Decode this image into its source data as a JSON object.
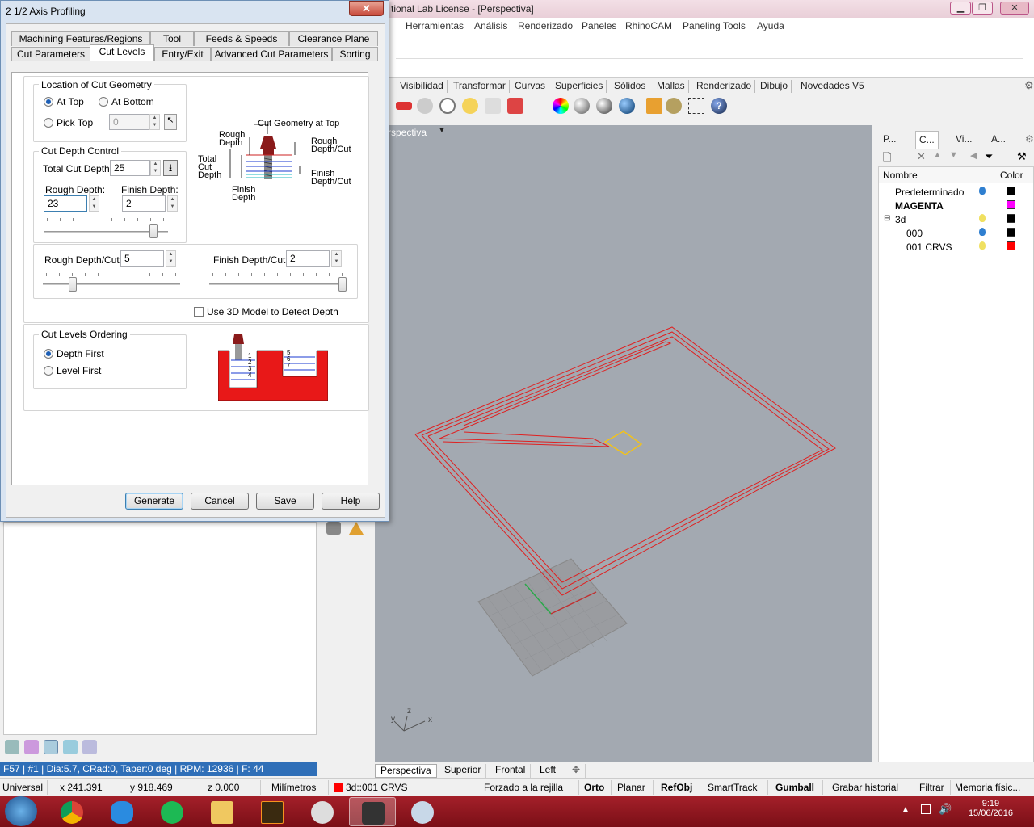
{
  "main_window": {
    "title": "tional Lab License - [Perspectiva]",
    "menu": [
      "Herramientas",
      "Análisis",
      "Renderizado",
      "Paneles",
      "RhinoCAM",
      "Paneling Tools",
      "Ayuda"
    ],
    "toolbar_tabs": [
      "Visibilidad",
      "Transformar",
      "Curvas",
      "Superficies",
      "Sólidos",
      "Mallas",
      "Renderizado",
      "Dibujo",
      "Novedades V5"
    ]
  },
  "viewport": {
    "title": "rspectiva",
    "tabs": [
      "Perspectiva",
      "Superior",
      "Frontal",
      "Left"
    ],
    "axis_x": "x",
    "axis_y": "y",
    "axis_z": "z"
  },
  "layers_panel": {
    "tabs": [
      "P...",
      "C...",
      "Vi...",
      "A..."
    ],
    "col_name": "Nombre",
    "col_color": "Color",
    "rows": [
      {
        "name": "Predeterminado",
        "bulb": "#2f7fd0",
        "color": "#000000",
        "bold": false,
        "indent": 0
      },
      {
        "name": "MAGENTA",
        "bulb": "",
        "color": "#ff00ff",
        "bold": true,
        "indent": 0
      },
      {
        "name": "3d",
        "bulb": "#f0e060",
        "color": "#000000",
        "bold": false,
        "indent": 0
      },
      {
        "name": "000",
        "bulb": "#2f7fd0",
        "color": "#000000",
        "bold": false,
        "indent": 1
      },
      {
        "name": "001 CRVS",
        "bulb": "#f0e060",
        "color": "#ff0000",
        "bold": false,
        "indent": 1
      }
    ]
  },
  "left_panel": {
    "status": "F57 | #1 | Dia:5.7, CRad:0, Taper:0 deg | RPM: 12936 | F: 44"
  },
  "statusbar": {
    "cplane": "Universal",
    "x": "x 241.391",
    "y": "y 918.469",
    "z": "z 0.000",
    "units": "Milímetros",
    "layer": "3d::001 CRVS",
    "layer_color": "#ff0000",
    "snap": "Forzado a la rejilla",
    "orto": "Orto",
    "planar": "Planar",
    "refobj": "RefObj",
    "smarttrack": "SmartTrack",
    "gumball": "Gumball",
    "history": "Grabar historial",
    "filter": "Filtrar",
    "memory": "Memoria físic..."
  },
  "taskbar": {
    "time": "9:19",
    "date": "15/06/2016"
  },
  "dialog": {
    "title": "2 1/2 Axis Profiling",
    "close": "✕",
    "tabs_row1": [
      "Machining Features/Regions",
      "Tool",
      "Feeds & Speeds",
      "Clearance Plane"
    ],
    "tabs_row2": [
      "Cut Parameters",
      "Cut Levels",
      "Entry/Exit",
      "Advanced Cut Parameters",
      "Sorting"
    ],
    "location_group": "Location of Cut Geometry",
    "at_top": "At Top",
    "at_bottom": "At Bottom",
    "pick_top": "Pick Top",
    "pick_top_value": "0",
    "depth_group": "Cut Depth Control",
    "total_cut_depth_label": "Total Cut Depth:",
    "total_cut_depth": "25",
    "rough_depth_label": "Rough Depth:",
    "rough_depth": "23",
    "finish_depth_label": "Finish Depth:",
    "finish_depth": "2",
    "rough_depth_cut_label": "Rough Depth/Cut:",
    "rough_depth_cut": "5",
    "finish_depth_cut_label": "Finish Depth/Cut:",
    "finish_depth_cut": "2",
    "use_3d_model": "Use 3D Model to Detect Depth",
    "ordering_group": "Cut Levels Ordering",
    "depth_first": "Depth First",
    "level_first": "Level First",
    "diagram": {
      "cut_geometry_at_top": "Cut Geometry at Top",
      "rough_depth_1": "Rough",
      "rough_depth_2": "Depth",
      "total_1": "Total",
      "total_2": "Cut",
      "total_3": "Depth",
      "finish_1": "Finish",
      "finish_2": "Depth",
      "rough_dc_1": "Rough",
      "rough_dc_2": "Depth/Cut",
      "finish_dc_1": "Finish",
      "finish_dc_2": "Depth/Cut"
    },
    "order_numbers_left": [
      "1",
      "2",
      "3",
      "4"
    ],
    "order_numbers_right": [
      "5",
      "6",
      "7"
    ],
    "buttons": {
      "generate": "Generate",
      "cancel": "Cancel",
      "save": "Save",
      "help": "Help"
    }
  }
}
